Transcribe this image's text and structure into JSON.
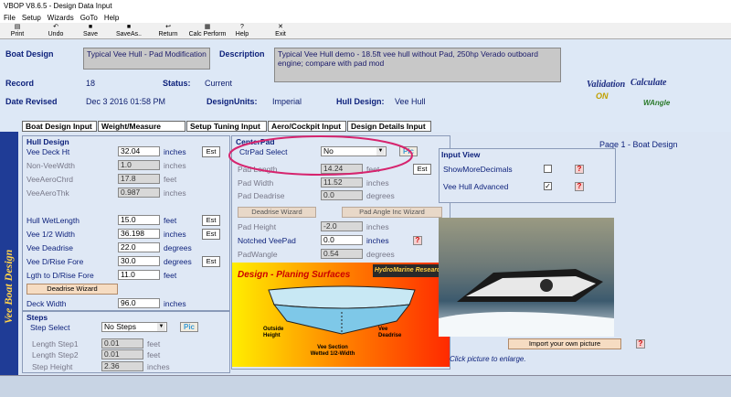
{
  "window": {
    "title": "VBOP V8.6.5 - Design Data Input"
  },
  "menu": [
    "File",
    "Setup",
    "Wizards",
    "GoTo",
    "Help"
  ],
  "toolbar": {
    "print": "Print",
    "undo": "Undo",
    "save": "Save",
    "saveas": "SaveAs..",
    "return": "Return",
    "calc": "Calc Perform",
    "help": "Help",
    "exit": "Exit"
  },
  "header": {
    "boat_design_label": "Boat Design",
    "boat_design_value": "Typical Vee Hull - Pad Modification",
    "description_label": "Description",
    "description_value": "Typical Vee Hull demo - 18.5ft vee hull without Pad, 250hp Verado outboard engine; compare with pad mod",
    "record_label": "Record",
    "record_value": "18",
    "status_label": "Status:",
    "status_value": "Current",
    "date_label": "Date Revised",
    "date_value": "Dec 3 2016 01:58 PM",
    "units_label": "DesignUnits:",
    "units_value": "Imperial",
    "hull_label": "Hull Design:",
    "hull_value": "Vee Hull",
    "validation_logo": "Validation",
    "validation_on": "ON",
    "calculate_logo": "Calculate",
    "wangle": "WAngle"
  },
  "tabs": [
    "Boat Design Input",
    "Weight/Measure Input",
    "Setup Tuning Input",
    "Aero/Cockpit Input",
    "Design Details Input"
  ],
  "side_title": "Vee Boat Design",
  "page_label": "Page 1 - Boat Design",
  "hull": {
    "title": "Hull Design",
    "rows": [
      {
        "label": "Vee Deck Ht",
        "value": "32.04",
        "unit": "inches",
        "est": "Est"
      },
      {
        "label": "Non-VeeWdth",
        "value": "1.0",
        "unit": "inches"
      },
      {
        "label": "VeeAeroChrd",
        "value": "17.8",
        "unit": "feet"
      },
      {
        "label": "VeeAeroThk",
        "value": "0.987",
        "unit": "inches"
      },
      {
        "label": "Hull WetLength",
        "value": "15.0",
        "unit": "feet",
        "est": "Est"
      },
      {
        "label": "Vee 1/2 Width",
        "value": "36.198",
        "unit": "inches",
        "est": "Est"
      },
      {
        "label": "Vee Deadrise",
        "value": "22.0",
        "unit": "degrees"
      },
      {
        "label": "Vee D/Rise Fore",
        "value": "30.0",
        "unit": "degrees",
        "est": "Est"
      },
      {
        "label": "Lgth to D/Rise Fore",
        "value": "11.0",
        "unit": "feet"
      }
    ],
    "wizard": "Deadrise Wizard",
    "deck_label": "Deck Width",
    "deck_value": "96.0",
    "deck_unit": "inches"
  },
  "steps": {
    "title": "Steps",
    "select_label": "Step Select",
    "select_value": "No Steps",
    "pic": "Pic",
    "rows": [
      {
        "label": "Length Step1",
        "value": "0.01",
        "unit": "feet"
      },
      {
        "label": "Length Step2",
        "value": "0.01",
        "unit": "feet"
      },
      {
        "label": "Step Height",
        "value": "2.36",
        "unit": "inches"
      }
    ]
  },
  "centerpad": {
    "title": "CenterPad",
    "select_label": "CtrPad Select",
    "select_value": "No",
    "pic": "Pic",
    "est": "Est",
    "rows": [
      {
        "label": "Pad Length",
        "value": "14.24",
        "unit": "feet"
      },
      {
        "label": "Pad Width",
        "value": "11.52",
        "unit": "inches"
      },
      {
        "label": "Pad Deadrise",
        "value": "0.0",
        "unit": "degrees"
      }
    ],
    "deadrise_wizard": "Deadrise Wizard",
    "angle_wizard": "Pad Angle Inc Wizard",
    "height_label": "Pad Height",
    "height_value": "-2.0",
    "height_unit": "inches",
    "notched_label": "Notched VeePad",
    "notched_value": "0.0",
    "notched_unit": "inches",
    "wangle_label": "PadWangle",
    "wangle_value": "0.54",
    "wangle_unit": "degrees"
  },
  "diagram": {
    "title": "Design - Planing Surfaces",
    "brand": "HydroMarine Research",
    "outside": "Outside Height",
    "vee_section": "Vee Section Wetted 1/2-Width",
    "vee_deadrise": "Vee Deadrise"
  },
  "input_view": {
    "title": "Input View",
    "items": [
      {
        "label": "ShowMoreDecimals",
        "checked": ""
      },
      {
        "label": "Vee Hull Advanced",
        "checked": "✓"
      }
    ]
  },
  "import_btn": "Import your own picture",
  "click_hint": "Click picture to enlarge.",
  "colors": {
    "accent": "#1f3c96",
    "annotation": "#d6246e"
  }
}
